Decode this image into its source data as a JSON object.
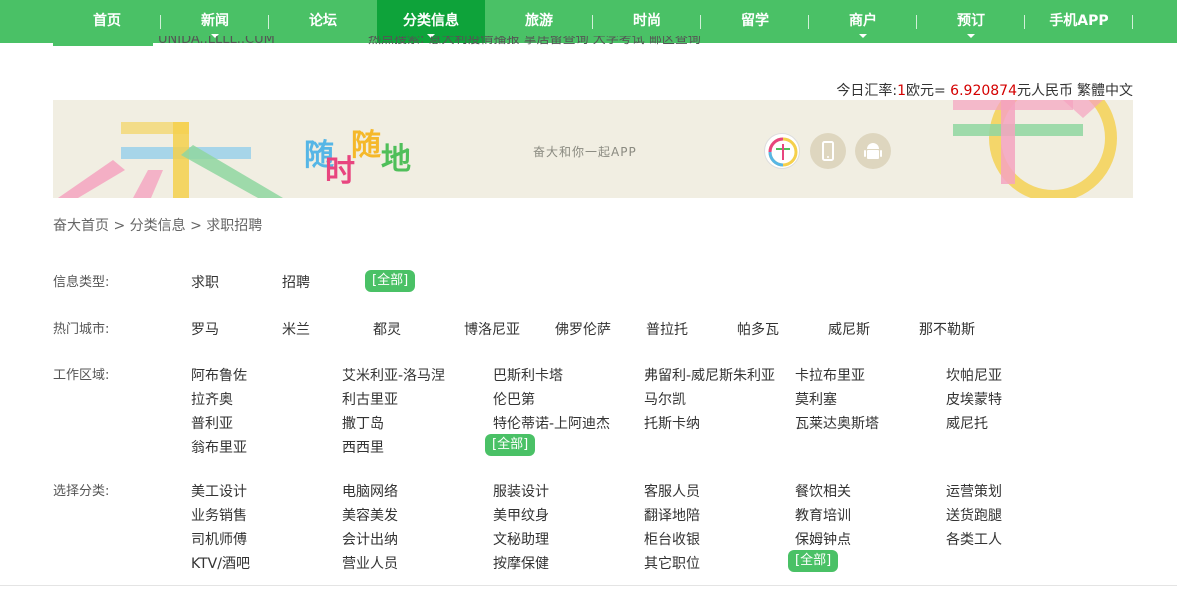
{
  "nav": {
    "items": [
      "首页",
      "新闻",
      "论坛",
      "分类信息",
      "旅游",
      "时尚",
      "留学",
      "商户",
      "预订",
      "手机APP"
    ],
    "active": "分类信息"
  },
  "header": {
    "cut_site_text": "UNIDA..LLLL..CUM",
    "cut_hot_search": "热点搜索:  意大利疫情播报   拿居留查询   大学考试   邮区查询"
  },
  "rate": {
    "prefix": "今日汇率:",
    "amount": "1",
    "unit_from": "欧元=",
    "value": " 6.920874",
    "unit_to": "元人民币",
    "lang_toggle": "繁體中文"
  },
  "banner": {
    "slogan_chars": [
      "随",
      "时",
      "随",
      "地"
    ],
    "tagline": "奋大和你一起APP",
    "icons": [
      "fenda-app-icon",
      "phone-icon",
      "android-icon"
    ],
    "colors": {
      "blue": "#60b8e4",
      "pink": "#f28fb0",
      "green": "#7ed37a",
      "yellow": "#f5d04c",
      "orange": "#f59e42",
      "red": "#e04a4a"
    }
  },
  "breadcrumb": {
    "home": "奋大首页",
    "sep": ">",
    "level2": "分类信息",
    "level3": "求职招聘"
  },
  "filters": {
    "type": {
      "label": "信息类型:",
      "options": [
        "求职",
        "招聘"
      ],
      "all": "[全部]"
    },
    "city": {
      "label": "热门城市:",
      "options": [
        "罗马",
        "米兰",
        "都灵",
        "博洛尼亚",
        "佛罗伦萨",
        "普拉托",
        "帕多瓦",
        "威尼斯",
        "那不勒斯"
      ]
    },
    "region": {
      "label": "工作区域:",
      "rows": [
        [
          "阿布鲁佐",
          "艾米利亚-洛马涅",
          "巴斯利卡塔",
          "弗留利-威尼斯朱利亚",
          "卡拉布里亚",
          "坎帕尼亚"
        ],
        [
          "拉齐奥",
          "利古里亚",
          "伦巴第",
          "马尔凯",
          "莫利塞",
          "皮埃蒙特"
        ],
        [
          "普利亚",
          "撒丁岛",
          "特伦蒂诺-上阿迪杰",
          "托斯卡纳",
          "瓦莱达奥斯塔",
          "威尼托"
        ],
        [
          "翁布里亚",
          "西西里"
        ]
      ],
      "all": "[全部]"
    },
    "category": {
      "label": "选择分类:",
      "rows": [
        [
          "美工设计",
          "电脑网络",
          "服装设计",
          "客服人员",
          "餐饮相关",
          "运营策划"
        ],
        [
          "业务销售",
          "美容美发",
          "美甲纹身",
          "翻译地陪",
          "教育培训",
          "送货跑腿"
        ],
        [
          "司机师傅",
          "会计出纳",
          "文秘助理",
          "柜台收银",
          "保姆钟点",
          "各类工人"
        ],
        [
          "KTV/酒吧",
          "营业人员",
          "按摩保健",
          "其它职位"
        ]
      ],
      "all": "[全部]"
    }
  },
  "accent": "#4ac166",
  "accent_dark": "#0ea33a"
}
